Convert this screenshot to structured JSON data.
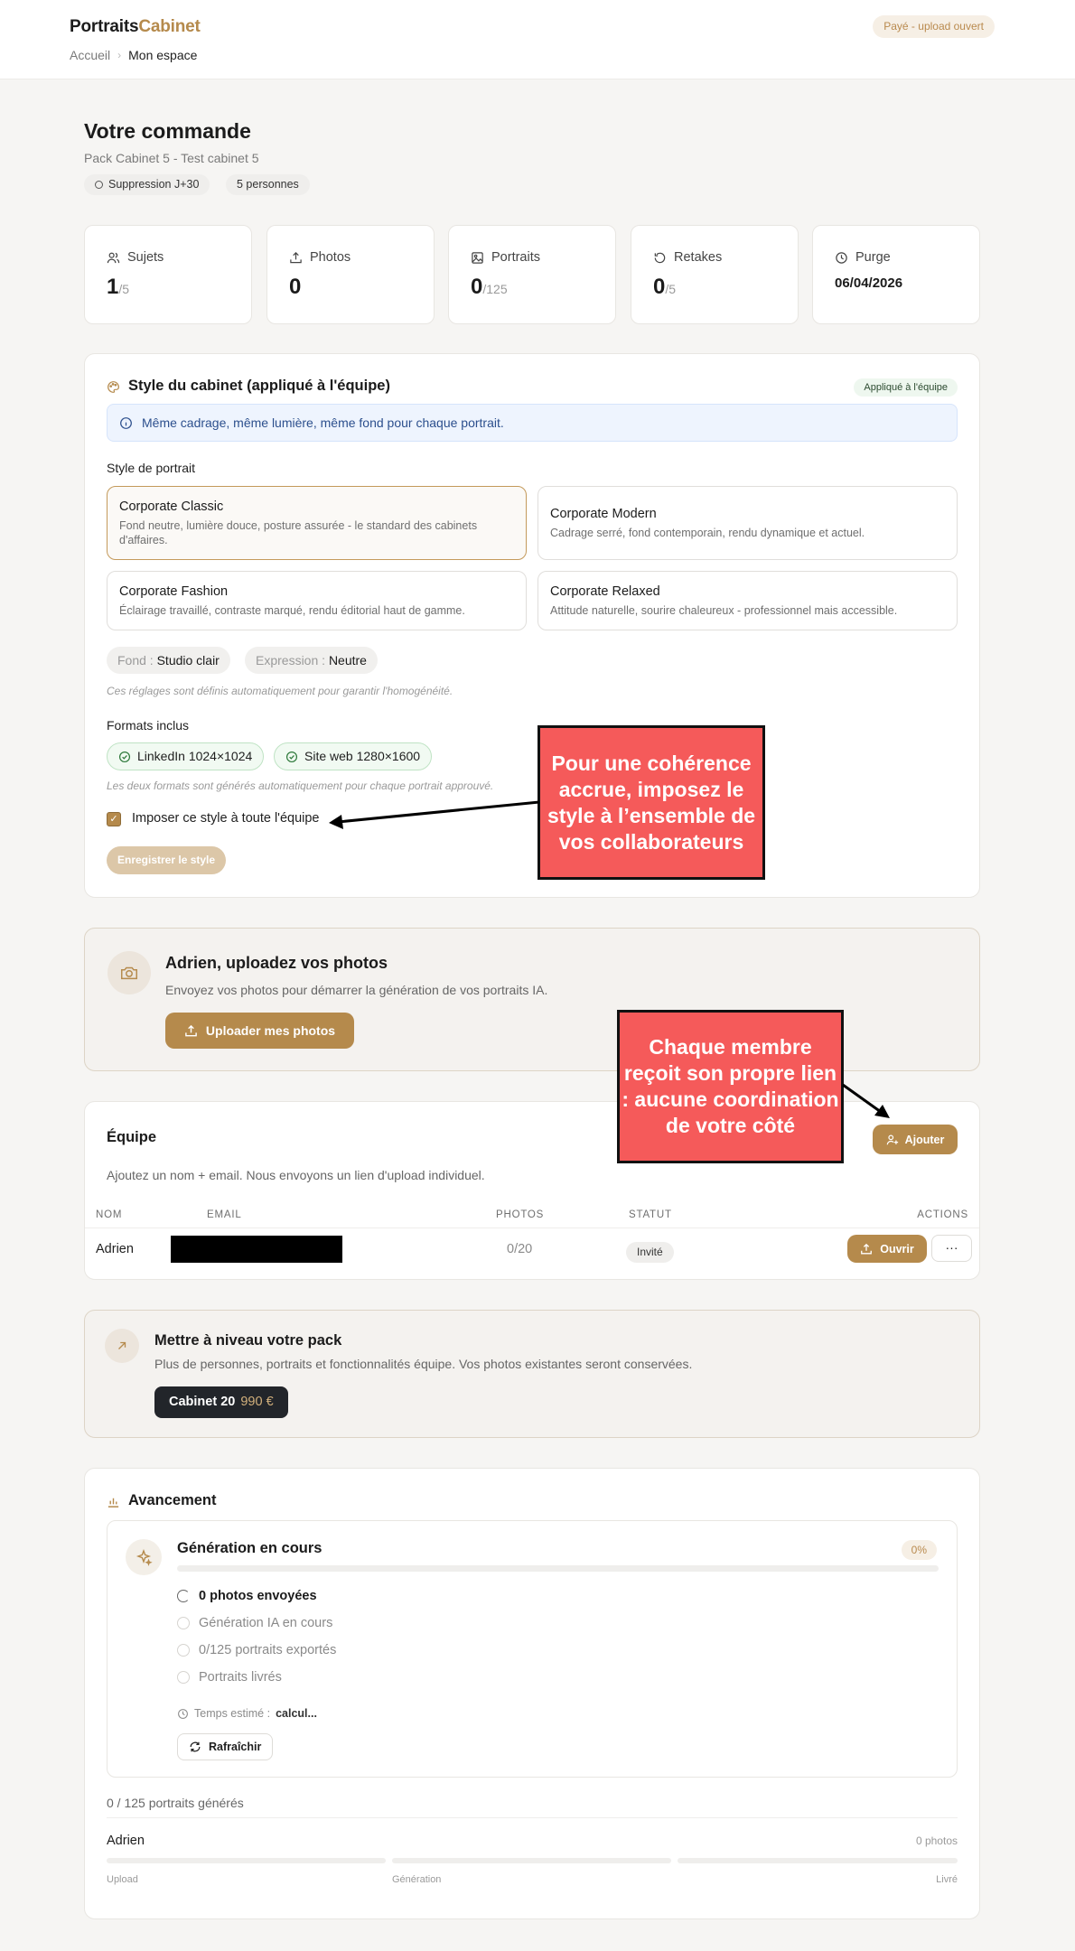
{
  "header": {
    "brand_part1": "Portraits",
    "brand_part2": "Cabinet",
    "breadcrumb": [
      "Accueil",
      "Mon espace"
    ],
    "status_pill": "Payé - upload ouvert"
  },
  "order": {
    "title": "Votre commande",
    "subtitle": "Pack Cabinet 5 - Test cabinet 5",
    "chips": [
      "Suppression J+30",
      "5 personnes"
    ]
  },
  "stats": [
    {
      "label": "Sujets",
      "value": "1",
      "denominator": "/5",
      "icon": "users-icon"
    },
    {
      "label": "Photos",
      "value": "0",
      "denominator": "",
      "icon": "upload-icon"
    },
    {
      "label": "Portraits",
      "value": "0",
      "denominator": "/125",
      "icon": "image-icon"
    },
    {
      "label": "Retakes",
      "value": "0",
      "denominator": "/5",
      "icon": "refresh-icon"
    },
    {
      "label": "Purge",
      "value": "06/04/2026",
      "denominator": "",
      "icon": "clock-icon"
    }
  ],
  "style_section": {
    "title": "Style du cabinet (appliqué à l'équipe)",
    "applied_tag": "Appliqué à l'équipe",
    "info": "Même cadrage, même lumière, même fond pour chaque portrait.",
    "portrait_style_label": "Style de portrait",
    "options": [
      {
        "title": "Corporate Classic",
        "desc": "Fond neutre, lumière douce, posture assurée - le standard des cabinets d'affaires.",
        "selected": true
      },
      {
        "title": "Corporate Modern",
        "desc": "Cadrage serré, fond contemporain, rendu dynamique et actuel.",
        "selected": false
      },
      {
        "title": "Corporate Fashion",
        "desc": "Éclairage travaillé, contraste marqué, rendu éditorial haut de gamme.",
        "selected": false
      },
      {
        "title": "Corporate Relaxed",
        "desc": "Attitude naturelle, sourire chaleureux - professionnel mais accessible.",
        "selected": false
      }
    ],
    "fond_key": "Fond :",
    "fond_value": "Studio clair",
    "expression_key": "Expression :",
    "expression_value": "Neutre",
    "auto_hint": "Ces réglages sont définis automatiquement pour garantir l'homogénéité.",
    "formats_label": "Formats inclus",
    "formats": [
      "LinkedIn 1024×1024",
      "Site web 1280×1600"
    ],
    "formats_hint": "Les deux formats sont générés automatiquement pour chaque portrait approuvé.",
    "impose_label": "Imposer ce style à toute l'équipe",
    "impose_checked": true,
    "save_button": "Enregistrer le style"
  },
  "annotations": {
    "callout1": "Pour une cohérence accrue, imposez le style à l’ensemble de vos collaborateurs",
    "callout2": "Chaque membre reçoit son propre lien : aucune coordination de votre côté"
  },
  "upload": {
    "title": "Adrien, uploadez vos photos",
    "desc": "Envoyez vos photos pour démarrer la génération de vos portraits IA.",
    "button": "Uploader mes photos"
  },
  "team": {
    "title": "Équipe",
    "add_button": "Ajouter",
    "desc": "Ajoutez un nom + email. Nous envoyons un lien d'upload individuel.",
    "columns": [
      "NOM",
      "EMAIL",
      "PHOTOS",
      "STATUT",
      "ACTIONS"
    ],
    "rows": [
      {
        "name": "Adrien",
        "photos_current": "0",
        "photos_max": "/20",
        "status": "Invité",
        "open_button": "Ouvrir",
        "more": "···"
      }
    ]
  },
  "upgrade": {
    "title": "Mettre à niveau votre pack",
    "desc": "Plus de personnes, portraits et fonctionnalités équipe. Vos photos existantes seront conservées.",
    "offer_name": "Cabinet 20",
    "offer_price": "990 €"
  },
  "progress": {
    "title": "Avancement",
    "gen_title": "Génération en cours",
    "percent_label": "0%",
    "percent_value": 0,
    "steps": [
      {
        "label": "0 photos envoyées",
        "active": true
      },
      {
        "label": "Génération IA en cours",
        "active": false
      },
      {
        "label": "0/125 portraits exportés",
        "active": false
      },
      {
        "label": "Portraits livrés",
        "active": false
      }
    ],
    "eta_label": "Temps estimé :",
    "eta_value": "calcul...",
    "refresh_button": "Rafraîchir",
    "summary": "0 / 125 portraits générés",
    "member_name": "Adrien",
    "member_photos": "0 photos",
    "phases": [
      "Upload",
      "Génération",
      "Livré"
    ]
  },
  "colors": {
    "accent": "#b58a4c",
    "callout": "#f55a5a"
  }
}
